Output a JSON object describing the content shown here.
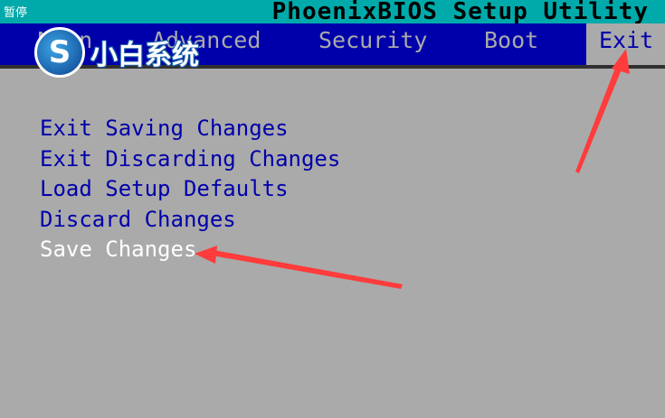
{
  "title_bar": {
    "paused_label": "暂停",
    "app_title": "PhoenixBIOS Setup Utility"
  },
  "menu": {
    "tabs": [
      {
        "label": "Main",
        "active": false
      },
      {
        "label": "Advanced",
        "active": false
      },
      {
        "label": "Security",
        "active": false
      },
      {
        "label": "Boot",
        "active": false
      },
      {
        "label": "Exit",
        "active": true
      }
    ]
  },
  "watermark": {
    "icon": "logo-s-icon",
    "text": "小白系统"
  },
  "exit_menu": {
    "options": [
      {
        "label": "Exit Saving Changes",
        "selected": false
      },
      {
        "label": "Exit Discarding Changes",
        "selected": false
      },
      {
        "label": "Load Setup Defaults",
        "selected": false
      },
      {
        "label": "Discard Changes",
        "selected": false
      },
      {
        "label": "Save Changes",
        "selected": true
      }
    ]
  },
  "colors": {
    "background": "#aaaaaa",
    "title_bar": "#00aaaa",
    "menu_bar": "#0000aa",
    "option_text": "#0000aa",
    "selected_text": "#ffffff",
    "annotation_arrow": "#ff3b3b"
  }
}
